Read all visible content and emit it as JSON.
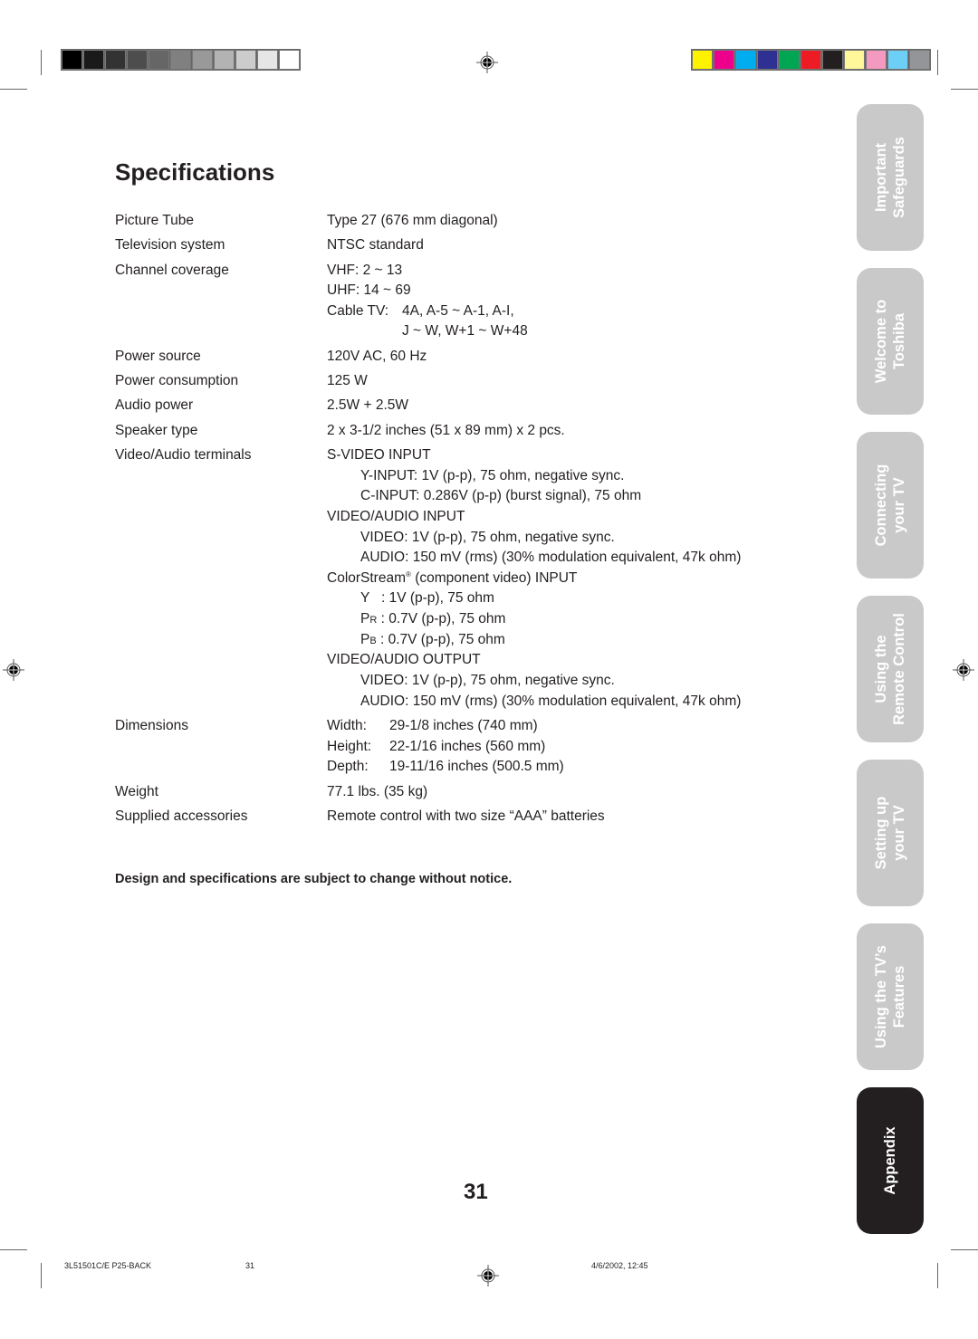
{
  "calibration": {
    "grayscale": [
      "#000000",
      "#1a1a1a",
      "#333333",
      "#4d4d4d",
      "#666666",
      "#808080",
      "#999999",
      "#b3b3b3",
      "#cccccc",
      "#e6e6e6",
      "#ffffff"
    ],
    "color": [
      "#fff200",
      "#ec008c",
      "#00aeef",
      "#2e3192",
      "#00a651",
      "#ed1c24",
      "#231f20",
      "#fff799",
      "#f49ac1",
      "#6dcff6",
      "#939598"
    ]
  },
  "page": {
    "title": "Specifications",
    "page_number": "31",
    "notice": "Design and specifications are subject to change without notice."
  },
  "specs": {
    "picture_tube": {
      "label": "Picture Tube",
      "value": "Type 27 (676 mm diagonal)"
    },
    "tv_system": {
      "label": "Television system",
      "value": "NTSC standard"
    },
    "channel_coverage": {
      "label": "Channel coverage",
      "vhf": "VHF: 2 ~ 13",
      "uhf": "UHF: 14 ~ 69",
      "cable_label": "Cable TV:",
      "cable_1": "4A, A-5 ~ A-1, A-I,",
      "cable_2": "J ~ W, W+1 ~ W+48"
    },
    "power_source": {
      "label": "Power source",
      "value": "120V AC, 60 Hz"
    },
    "power_consumption": {
      "label": "Power consumption",
      "value": "125 W"
    },
    "audio_power": {
      "label": "Audio power",
      "value": "2.5W + 2.5W"
    },
    "speaker_type": {
      "label": "Speaker type",
      "value": "2 x 3-1/2 inches (51 x 89 mm) x 2 pcs."
    },
    "terminals": {
      "label": "Video/Audio terminals",
      "svideo": "S-VIDEO INPUT",
      "y_input": "Y-INPUT: 1V (p-p), 75 ohm, negative sync.",
      "c_input": "C-INPUT: 0.286V (p-p) (burst signal), 75 ohm",
      "va_input": "VIDEO/AUDIO INPUT",
      "va_in_video": "VIDEO: 1V (p-p), 75 ohm, negative sync.",
      "va_in_audio": "AUDIO: 150 mV (rms) (30% modulation equivalent, 47k ohm)",
      "colorstream": "ColorStream",
      "colorstream_reg": "®",
      "colorstream_rest": " (component video) INPUT",
      "cs_y": "Y   : 1V (p-p), 75 ohm",
      "cs_pr_p": "P",
      "cs_pr_sub": "R",
      "cs_pr": " : 0.7V (p-p), 75 ohm",
      "cs_pb_p": "P",
      "cs_pb_sub": "B",
      "cs_pb": " : 0.7V (p-p), 75 ohm",
      "va_output": "VIDEO/AUDIO OUTPUT",
      "va_out_video": "VIDEO: 1V (p-p), 75 ohm, negative sync.",
      "va_out_audio": "AUDIO: 150 mV (rms) (30% modulation equivalent, 47k ohm)"
    },
    "dimensions": {
      "label": "Dimensions",
      "width_label": "Width:",
      "width": "29-1/8 inches (740 mm)",
      "height_label": "Height:",
      "height": "22-1/16 inches (560 mm)",
      "depth_label": "Depth:",
      "depth": "19-11/16 inches (500.5 mm)"
    },
    "weight": {
      "label": "Weight",
      "value": "77.1 lbs. (35 kg)"
    },
    "accessories": {
      "label": "Supplied accessories",
      "value": "Remote control with two size “AAA” batteries"
    }
  },
  "side_tabs": [
    {
      "line1": "Important",
      "line2": "Safeguards",
      "active": false
    },
    {
      "line1": "Welcome to",
      "line2": "Toshiba",
      "active": false
    },
    {
      "line1": "Connecting",
      "line2": "your TV",
      "active": false
    },
    {
      "line1": "Using the",
      "line2": "Remote Control",
      "active": false
    },
    {
      "line1": "Setting up",
      "line2": "your TV",
      "active": false
    },
    {
      "line1": "Using the TV’s",
      "line2": "Features",
      "active": false
    },
    {
      "line1": "Appendix",
      "line2": "",
      "active": true
    }
  ],
  "footer": {
    "file": "3L51501C/E P25-BACK",
    "page": "31",
    "datetime": "4/6/2002, 12:45"
  }
}
